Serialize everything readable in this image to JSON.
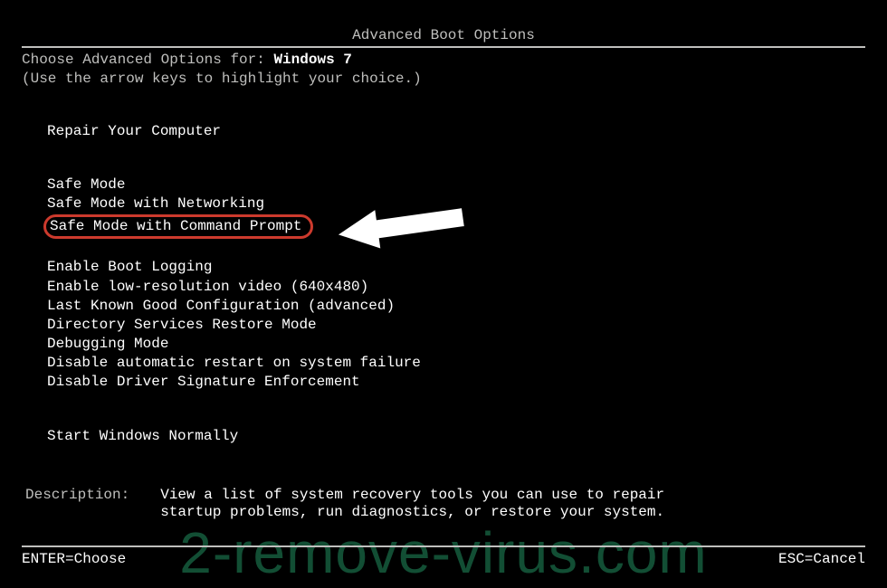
{
  "title": "Advanced Boot Options",
  "prompt": {
    "label": "Choose Advanced Options for: ",
    "os": "Windows 7"
  },
  "hint": "(Use the arrow keys to highlight your choice.)",
  "groups": {
    "repair": "Repair Your Computer",
    "safe": [
      "Safe Mode",
      "Safe Mode with Networking",
      "Safe Mode with Command Prompt"
    ],
    "advanced": [
      "Enable Boot Logging",
      "Enable low-resolution video (640x480)",
      "Last Known Good Configuration (advanced)",
      "Directory Services Restore Mode",
      "Debugging Mode",
      "Disable automatic restart on system failure",
      "Disable Driver Signature Enforcement"
    ],
    "normal": "Start Windows Normally"
  },
  "description": {
    "label": "Description:",
    "text": "View a list of system recovery tools you can use to repair startup problems, run diagnostics, or restore your system."
  },
  "footer": {
    "enter": "ENTER=Choose",
    "esc": "ESC=Cancel"
  },
  "watermark": "2-remove-virus.com",
  "highlight_index": 2
}
